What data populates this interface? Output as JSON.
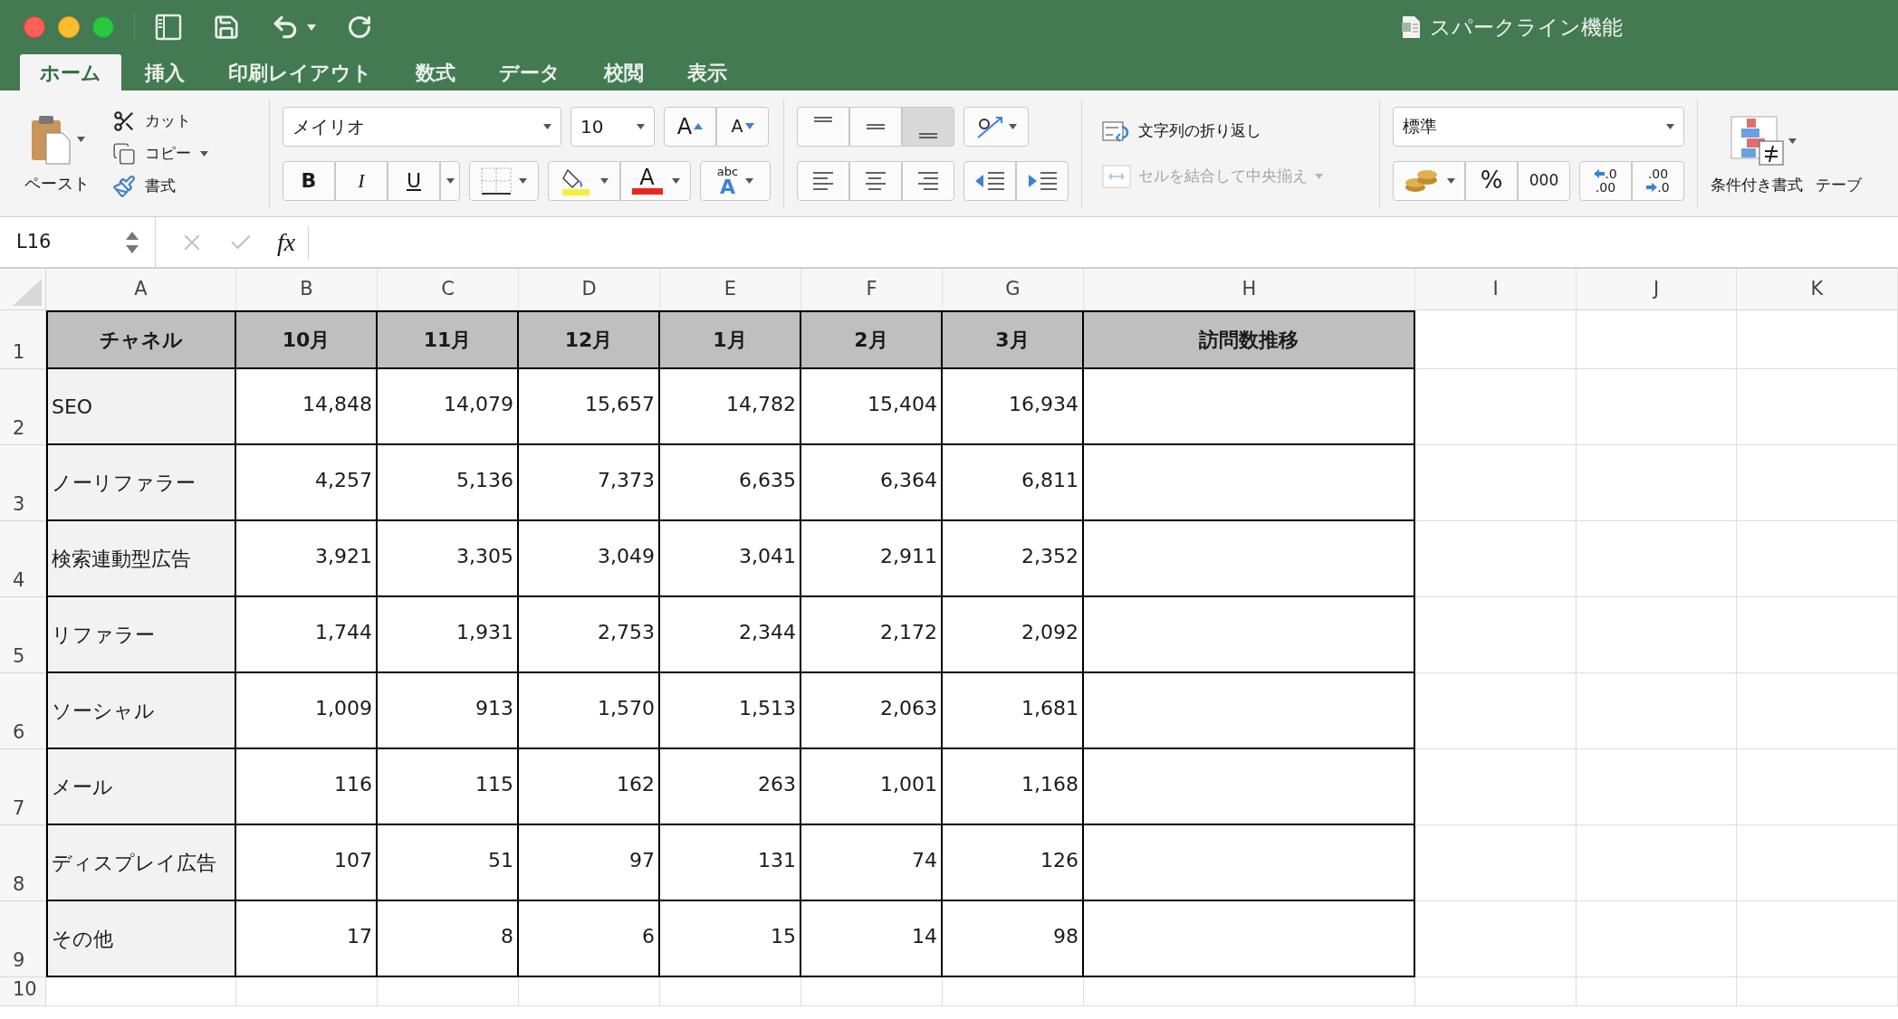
{
  "window": {
    "title": "スパークライン機能"
  },
  "tabs": [
    {
      "label": "ホーム",
      "selected": true
    },
    {
      "label": "挿入",
      "selected": false
    },
    {
      "label": "印刷レイアウト",
      "selected": false
    },
    {
      "label": "数式",
      "selected": false
    },
    {
      "label": "データ",
      "selected": false
    },
    {
      "label": "校閲",
      "selected": false
    },
    {
      "label": "表示",
      "selected": false
    }
  ],
  "ribbon": {
    "clipboard": {
      "paste": "ペースト",
      "cut": "カット",
      "copy": "コピー",
      "format": "書式"
    },
    "font": {
      "name": "メイリオ",
      "size": "10",
      "grow": "A",
      "shrink": "A",
      "bold": "B",
      "italic": "I",
      "underline": "U",
      "font_color": "A",
      "phonetic_small": "abc",
      "phonetic_big": "A"
    },
    "vertical_align": [
      {
        "kind": "top",
        "selected": false
      },
      {
        "kind": "middle",
        "selected": false
      },
      {
        "kind": "bottom",
        "selected": true
      }
    ],
    "horizontal_align": [
      {
        "kind": "left",
        "selected": false
      },
      {
        "kind": "center",
        "selected": false
      },
      {
        "kind": "right",
        "selected": false
      }
    ],
    "wrap_text": {
      "label": "文字列の折り返し",
      "disabled": false
    },
    "merge_center": {
      "label": "セルを結合して中央揃え",
      "disabled": true
    },
    "number": {
      "format": "標準",
      "percent": "%",
      "comma": "000",
      "increase_decimal": [
        ".0",
        ".00"
      ],
      "decrease_decimal": [
        ".00",
        ".0"
      ]
    },
    "conditional_format": "条件付き書式",
    "table_format": "テーブ"
  },
  "formula_bar": {
    "name_box": "L16",
    "fx": "fx"
  },
  "columns": [
    "A",
    "B",
    "C",
    "D",
    "E",
    "F",
    "G",
    "H",
    "I",
    "J",
    "K"
  ],
  "row_numbers": [
    "1",
    "2",
    "3",
    "4",
    "5",
    "6",
    "7",
    "8",
    "9",
    "10"
  ],
  "table": {
    "header": [
      "チャネル",
      "10月",
      "11月",
      "12月",
      "1月",
      "2月",
      "3月",
      "訪問数推移"
    ],
    "rows": [
      [
        "SEO",
        "14,848",
        "14,079",
        "15,657",
        "14,782",
        "15,404",
        "16,934"
      ],
      [
        "ノーリファラー",
        "4,257",
        "5,136",
        "7,373",
        "6,635",
        "6,364",
        "6,811"
      ],
      [
        "検索連動型広告",
        "3,921",
        "3,305",
        "3,049",
        "3,041",
        "2,911",
        "2,352"
      ],
      [
        "リファラー",
        "1,744",
        "1,931",
        "2,753",
        "2,344",
        "2,172",
        "2,092"
      ],
      [
        "ソーシャル",
        "1,009",
        "913",
        "1,570",
        "1,513",
        "2,063",
        "1,681"
      ],
      [
        "メール",
        "116",
        "115",
        "162",
        "263",
        "1,001",
        "1,168"
      ],
      [
        "ディスプレイ広告",
        "107",
        "51",
        "97",
        "131",
        "74",
        "126"
      ],
      [
        "その他",
        "17",
        "8",
        "6",
        "15",
        "14",
        "98"
      ]
    ]
  }
}
